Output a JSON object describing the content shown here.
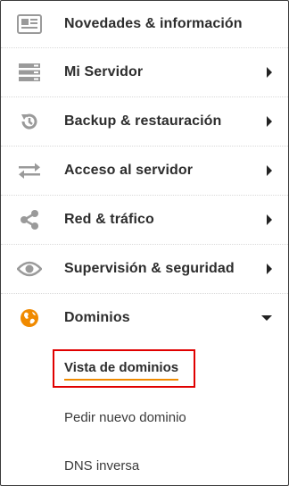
{
  "menu": {
    "items": [
      {
        "label": "Novedades & información",
        "icon": "news-icon",
        "has_arrow": false
      },
      {
        "label": "Mi Servidor",
        "icon": "server-icon",
        "has_arrow": true
      },
      {
        "label": "Backup & restauración",
        "icon": "backup-restore-icon",
        "has_arrow": true
      },
      {
        "label": "Acceso al servidor",
        "icon": "swap-arrows-icon",
        "has_arrow": true
      },
      {
        "label": "Red & tráfico",
        "icon": "share-network-icon",
        "has_arrow": true
      },
      {
        "label": "Supervisión & seguridad",
        "icon": "eye-icon",
        "has_arrow": true
      },
      {
        "label": "Dominios",
        "icon": "globe-icon",
        "expanded": true
      }
    ],
    "subitems": [
      {
        "label": "Vista de dominios",
        "active": true
      },
      {
        "label": "Pedir nuevo dominio",
        "active": false
      },
      {
        "label": "DNS inversa",
        "active": false
      }
    ]
  },
  "colors": {
    "accent": "#f08a00",
    "highlight_border": "#e00000",
    "icon_gray": "#9a9a9a"
  }
}
